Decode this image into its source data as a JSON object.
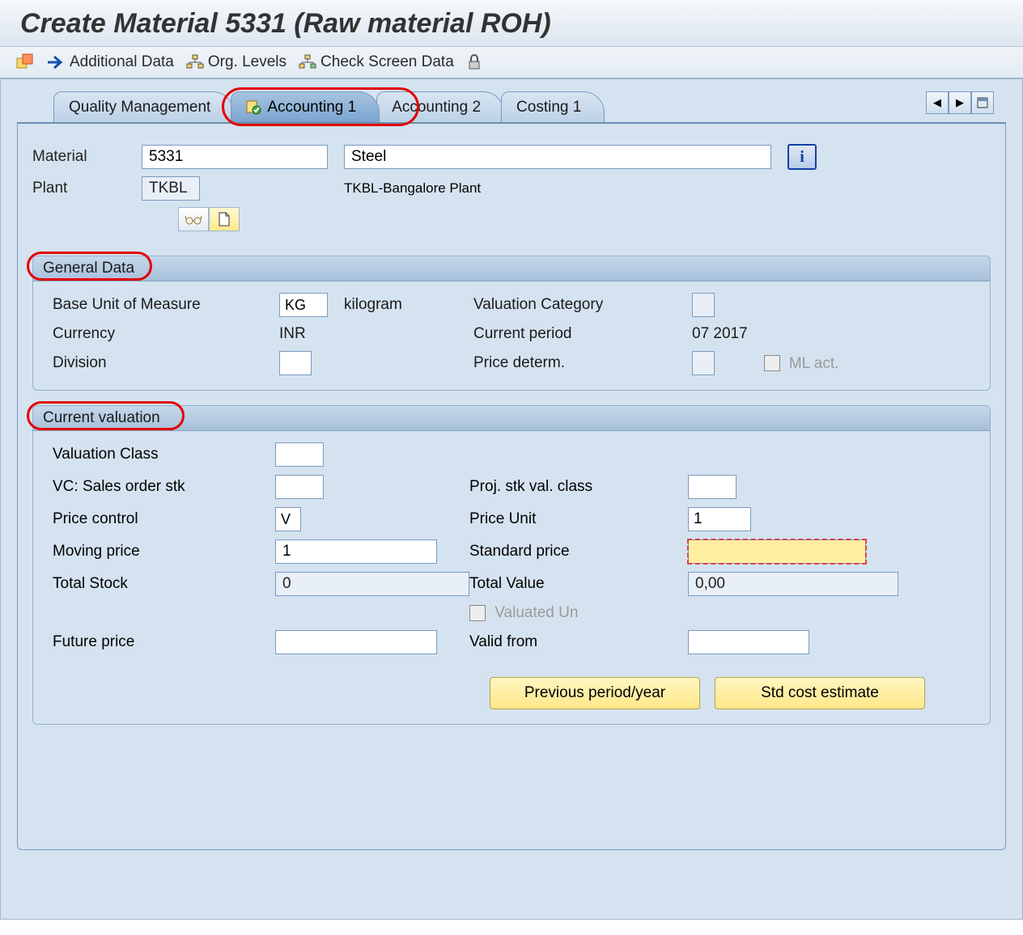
{
  "page_title": "Create Material 5331 (Raw material ROH)",
  "toolbar": {
    "additional_data": "Additional Data",
    "org_levels": "Org. Levels",
    "check_screen": "Check Screen Data"
  },
  "tabs": {
    "quality": "Quality Management",
    "acct1": "Accounting 1",
    "acct2": "Accounting 2",
    "costing1": "Costing 1"
  },
  "material": {
    "label": "Material",
    "number": "5331",
    "description": "Steel"
  },
  "plant": {
    "label": "Plant",
    "code": "TKBL",
    "name": "TKBL-Bangalore Plant"
  },
  "general_data": {
    "title": "General Data",
    "base_uom_label": "Base Unit of Measure",
    "base_uom": "KG",
    "base_uom_text": "kilogram",
    "valuation_cat_label": "Valuation Category",
    "currency_label": "Currency",
    "currency": "INR",
    "current_period_label": "Current period",
    "current_period": "07 2017",
    "division_label": "Division",
    "price_determ_label": "Price determ.",
    "ml_act_label": "ML act."
  },
  "current_valuation": {
    "title": "Current valuation",
    "valuation_class_label": "Valuation Class",
    "vc_sales_label": "VC: Sales order stk",
    "proj_stk_label": "Proj. stk val. class",
    "price_control_label": "Price control",
    "price_control": "V",
    "price_unit_label": "Price Unit",
    "price_unit": "1",
    "moving_price_label": "Moving price",
    "moving_price": "1",
    "standard_price_label": "Standard price",
    "total_stock_label": "Total Stock",
    "total_stock": "0",
    "total_value_label": "Total Value",
    "total_value": "0,00",
    "valuated_un_label": "Valuated Un",
    "future_price_label": "Future price",
    "valid_from_label": "Valid from"
  },
  "buttons": {
    "prev_period": "Previous period/year",
    "std_cost": "Std cost estimate"
  }
}
